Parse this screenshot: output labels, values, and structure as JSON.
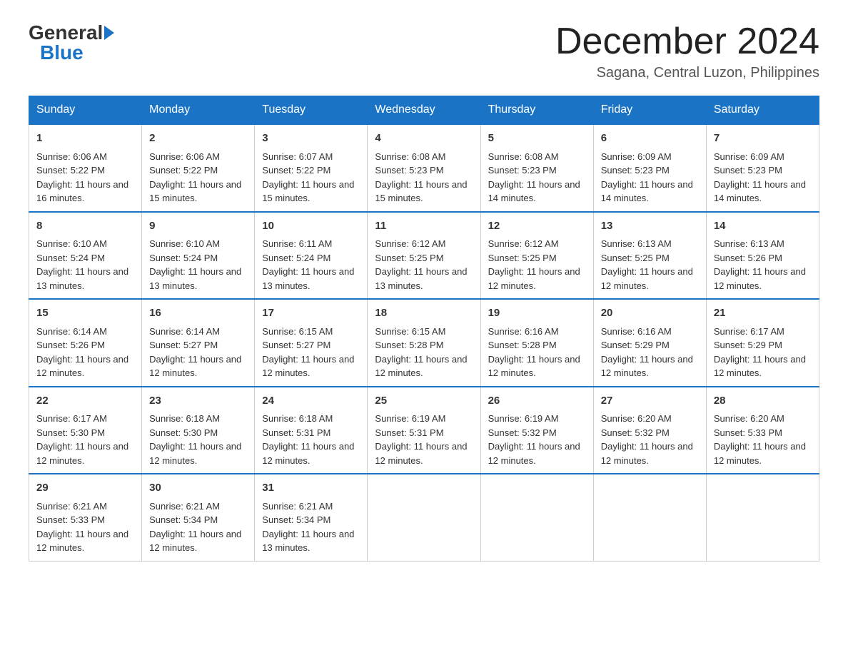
{
  "header": {
    "logo_general": "General",
    "logo_blue": "Blue",
    "month_title": "December 2024",
    "location": "Sagana, Central Luzon, Philippines"
  },
  "days_of_week": [
    "Sunday",
    "Monday",
    "Tuesday",
    "Wednesday",
    "Thursday",
    "Friday",
    "Saturday"
  ],
  "weeks": [
    [
      {
        "day": "1",
        "sunrise": "6:06 AM",
        "sunset": "5:22 PM",
        "daylight": "11 hours and 16 minutes."
      },
      {
        "day": "2",
        "sunrise": "6:06 AM",
        "sunset": "5:22 PM",
        "daylight": "11 hours and 15 minutes."
      },
      {
        "day": "3",
        "sunrise": "6:07 AM",
        "sunset": "5:22 PM",
        "daylight": "11 hours and 15 minutes."
      },
      {
        "day": "4",
        "sunrise": "6:08 AM",
        "sunset": "5:23 PM",
        "daylight": "11 hours and 15 minutes."
      },
      {
        "day": "5",
        "sunrise": "6:08 AM",
        "sunset": "5:23 PM",
        "daylight": "11 hours and 14 minutes."
      },
      {
        "day": "6",
        "sunrise": "6:09 AM",
        "sunset": "5:23 PM",
        "daylight": "11 hours and 14 minutes."
      },
      {
        "day": "7",
        "sunrise": "6:09 AM",
        "sunset": "5:23 PM",
        "daylight": "11 hours and 14 minutes."
      }
    ],
    [
      {
        "day": "8",
        "sunrise": "6:10 AM",
        "sunset": "5:24 PM",
        "daylight": "11 hours and 13 minutes."
      },
      {
        "day": "9",
        "sunrise": "6:10 AM",
        "sunset": "5:24 PM",
        "daylight": "11 hours and 13 minutes."
      },
      {
        "day": "10",
        "sunrise": "6:11 AM",
        "sunset": "5:24 PM",
        "daylight": "11 hours and 13 minutes."
      },
      {
        "day": "11",
        "sunrise": "6:12 AM",
        "sunset": "5:25 PM",
        "daylight": "11 hours and 13 minutes."
      },
      {
        "day": "12",
        "sunrise": "6:12 AM",
        "sunset": "5:25 PM",
        "daylight": "11 hours and 12 minutes."
      },
      {
        "day": "13",
        "sunrise": "6:13 AM",
        "sunset": "5:25 PM",
        "daylight": "11 hours and 12 minutes."
      },
      {
        "day": "14",
        "sunrise": "6:13 AM",
        "sunset": "5:26 PM",
        "daylight": "11 hours and 12 minutes."
      }
    ],
    [
      {
        "day": "15",
        "sunrise": "6:14 AM",
        "sunset": "5:26 PM",
        "daylight": "11 hours and 12 minutes."
      },
      {
        "day": "16",
        "sunrise": "6:14 AM",
        "sunset": "5:27 PM",
        "daylight": "11 hours and 12 minutes."
      },
      {
        "day": "17",
        "sunrise": "6:15 AM",
        "sunset": "5:27 PM",
        "daylight": "11 hours and 12 minutes."
      },
      {
        "day": "18",
        "sunrise": "6:15 AM",
        "sunset": "5:28 PM",
        "daylight": "11 hours and 12 minutes."
      },
      {
        "day": "19",
        "sunrise": "6:16 AM",
        "sunset": "5:28 PM",
        "daylight": "11 hours and 12 minutes."
      },
      {
        "day": "20",
        "sunrise": "6:16 AM",
        "sunset": "5:29 PM",
        "daylight": "11 hours and 12 minutes."
      },
      {
        "day": "21",
        "sunrise": "6:17 AM",
        "sunset": "5:29 PM",
        "daylight": "11 hours and 12 minutes."
      }
    ],
    [
      {
        "day": "22",
        "sunrise": "6:17 AM",
        "sunset": "5:30 PM",
        "daylight": "11 hours and 12 minutes."
      },
      {
        "day": "23",
        "sunrise": "6:18 AM",
        "sunset": "5:30 PM",
        "daylight": "11 hours and 12 minutes."
      },
      {
        "day": "24",
        "sunrise": "6:18 AM",
        "sunset": "5:31 PM",
        "daylight": "11 hours and 12 minutes."
      },
      {
        "day": "25",
        "sunrise": "6:19 AM",
        "sunset": "5:31 PM",
        "daylight": "11 hours and 12 minutes."
      },
      {
        "day": "26",
        "sunrise": "6:19 AM",
        "sunset": "5:32 PM",
        "daylight": "11 hours and 12 minutes."
      },
      {
        "day": "27",
        "sunrise": "6:20 AM",
        "sunset": "5:32 PM",
        "daylight": "11 hours and 12 minutes."
      },
      {
        "day": "28",
        "sunrise": "6:20 AM",
        "sunset": "5:33 PM",
        "daylight": "11 hours and 12 minutes."
      }
    ],
    [
      {
        "day": "29",
        "sunrise": "6:21 AM",
        "sunset": "5:33 PM",
        "daylight": "11 hours and 12 minutes."
      },
      {
        "day": "30",
        "sunrise": "6:21 AM",
        "sunset": "5:34 PM",
        "daylight": "11 hours and 12 minutes."
      },
      {
        "day": "31",
        "sunrise": "6:21 AM",
        "sunset": "5:34 PM",
        "daylight": "11 hours and 13 minutes."
      },
      null,
      null,
      null,
      null
    ]
  ]
}
